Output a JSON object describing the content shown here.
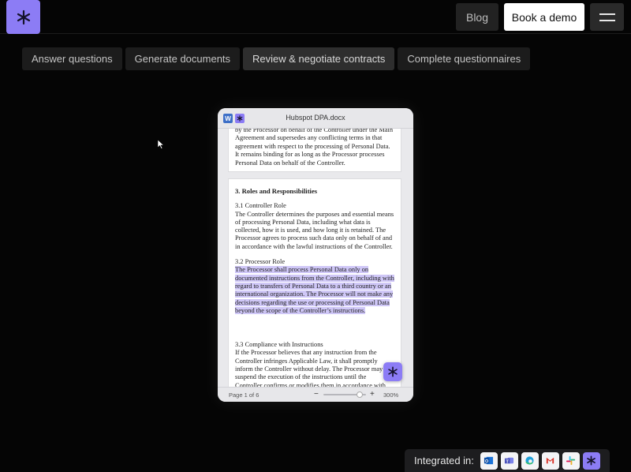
{
  "header": {
    "logo_icon": "asterisk-logo-icon",
    "blog_label": "Blog",
    "demo_label": "Book a demo",
    "menu_icon": "hamburger-menu-icon"
  },
  "tabs": [
    {
      "label": "Answer questions"
    },
    {
      "label": "Generate documents"
    },
    {
      "label": "Review & negotiate contracts"
    },
    {
      "label": "Complete questionnaires"
    }
  ],
  "document": {
    "filename": "Hubspot DPA.docx",
    "page1_text": "by the Processor on behalf of the Controller under the Main Agreement and supersedes any conflicting terms in that agreement with respect to the processing of Personal Data. It remains binding for as long as the Processor processes Personal Data on behalf of the Controller.",
    "section_title": "3. Roles and Responsibilities",
    "sub1_title": "3.1 Controller Role",
    "sub1_text": "The Controller determines the purposes and essential means of processing Personal Data, including what data is collected, how it is used, and how long it is retained. The Processor agrees to process such data only on behalf of and in accordance with the lawful instructions of the Controller.",
    "sub2_title": "3.2 Processor Role",
    "sub2_text": "The Processor shall process Personal Data only on documented instructions from the Controller, including with regard to transfers of Personal Data to a third country or an international organization. The Processor will not make any decisions regarding the use or processing of Personal Data beyond the scope of the Controller’s instructions.",
    "sub3_title": "3.3 Compliance with Instructions",
    "sub3_text": "If the Processor believes that any instruction from the Controller infringes Applicable Law, it shall promptly inform the Controller without delay. The Processor may suspend the execution of the instructions until the Controller confirms or modifies them in accordance with Applicable Law.",
    "page_indicator": "Page 1 of 6",
    "zoom_minus": "−",
    "zoom_plus": "+",
    "zoom_value": "300%"
  },
  "integrated": {
    "label": "Integrated in:",
    "apps": [
      "outlook-icon",
      "teams-icon",
      "edge-icon",
      "gmail-icon",
      "slack-icon",
      "asterisk-logo-icon"
    ]
  },
  "colors": {
    "brand": "#8c7cf5",
    "highlight": "#cfc7f7",
    "background": "#050505"
  }
}
